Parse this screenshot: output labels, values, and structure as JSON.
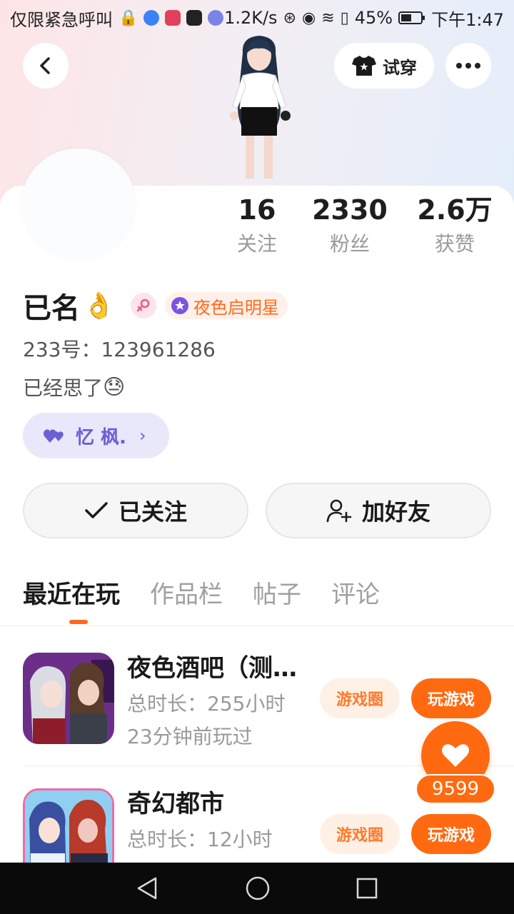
{
  "status_bar": {
    "carrier": "仅限紧急呼叫",
    "speed": "1.2K/s",
    "battery": "45%",
    "time": "下午1:47"
  },
  "header": {
    "try_on_label": "试穿"
  },
  "stats": [
    {
      "value": "16",
      "label": "关注"
    },
    {
      "value": "2330",
      "label": "粉丝"
    },
    {
      "value": "2.6万",
      "label": "获赞"
    }
  ],
  "profile": {
    "name": "已名",
    "title_badge": "夜色启明星",
    "uid": "233号：123961286",
    "bio": "已经思了",
    "partner": "忆 枫."
  },
  "actions": {
    "followed_label": "已关注",
    "add_friend_label": "加好友"
  },
  "tabs": [
    "最近在玩",
    "作品栏",
    "帖子",
    "评论"
  ],
  "games": [
    {
      "title": "夜色酒吧（测试服）",
      "duration": "总时长：255小时",
      "last_played": "23分钟前玩过",
      "circle_label": "游戏圈",
      "play_label": "玩游戏"
    },
    {
      "title": "奇幻都市",
      "duration": "总时长：12小时",
      "last_played": "",
      "circle_label": "游戏圈",
      "play_label": "玩游戏"
    }
  ],
  "like_count": "9599",
  "colors": {
    "accent": "#ff6a10",
    "partner": "#6b5fd6",
    "muted": "#9a9a9a"
  }
}
